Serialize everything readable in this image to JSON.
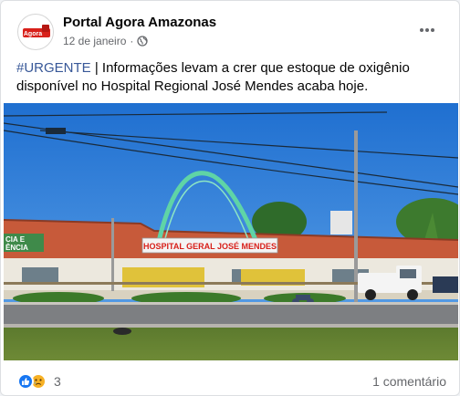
{
  "post": {
    "page_name": "Portal Agora Amazonas",
    "date": "12 de janeiro",
    "separator": "·",
    "hashtag": "#URGENTE",
    "text_body": " | Informações levam a crer que estoque de oxigênio disponível no Hospital Regional José Mendes acaba hoje.",
    "avatar_logo_text": "Agora"
  },
  "image": {
    "sign_text": "HOSPITAL GERAL JOSÉ MENDES",
    "left_sign_line1": "CIA E",
    "left_sign_line2": "ÊNCIA"
  },
  "footer": {
    "reaction_count": "3",
    "comments_label": "1 comentário",
    "reaction_icons": [
      "like-icon",
      "sad-icon"
    ]
  },
  "colors": {
    "brand_red": "#d8201a",
    "link": "#385898",
    "like": "#1877f2",
    "sad": "#f7b125"
  }
}
